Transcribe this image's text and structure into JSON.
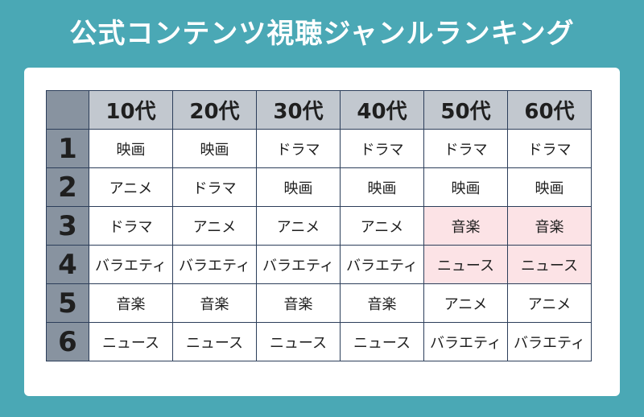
{
  "page": {
    "title": "公式コンテンツ視聴ジャンルランキング"
  },
  "colors": {
    "background": "#4aa8b5",
    "header_bg": "#c2c8cf",
    "rank_bg": "#8893a0",
    "highlight_bg": "#fce3e6",
    "border": "#2c3e5a"
  },
  "chart_data": {
    "type": "table",
    "title": "公式コンテンツ視聴ジャンルランキング",
    "columns": [
      "10代",
      "20代",
      "30代",
      "40代",
      "50代",
      "60代"
    ],
    "rows": [
      {
        "rank": "1",
        "cells": [
          "映画",
          "映画",
          "ドラマ",
          "ドラマ",
          "ドラマ",
          "ドラマ"
        ],
        "highlight": [
          false,
          false,
          false,
          false,
          false,
          false
        ]
      },
      {
        "rank": "2",
        "cells": [
          "アニメ",
          "ドラマ",
          "映画",
          "映画",
          "映画",
          "映画"
        ],
        "highlight": [
          false,
          false,
          false,
          false,
          false,
          false
        ]
      },
      {
        "rank": "3",
        "cells": [
          "ドラマ",
          "アニメ",
          "アニメ",
          "アニメ",
          "音楽",
          "音楽"
        ],
        "highlight": [
          false,
          false,
          false,
          false,
          true,
          true
        ]
      },
      {
        "rank": "4",
        "cells": [
          "バラエティ",
          "バラエティ",
          "バラエティ",
          "バラエティ",
          "ニュース",
          "ニュース"
        ],
        "highlight": [
          false,
          false,
          false,
          false,
          true,
          true
        ]
      },
      {
        "rank": "5",
        "cells": [
          "音楽",
          "音楽",
          "音楽",
          "音楽",
          "アニメ",
          "アニメ"
        ],
        "highlight": [
          false,
          false,
          false,
          false,
          false,
          false
        ]
      },
      {
        "rank": "6",
        "cells": [
          "ニュース",
          "ニュース",
          "ニュース",
          "ニュース",
          "バラエティ",
          "バラエティ"
        ],
        "highlight": [
          false,
          false,
          false,
          false,
          false,
          false
        ]
      }
    ]
  }
}
